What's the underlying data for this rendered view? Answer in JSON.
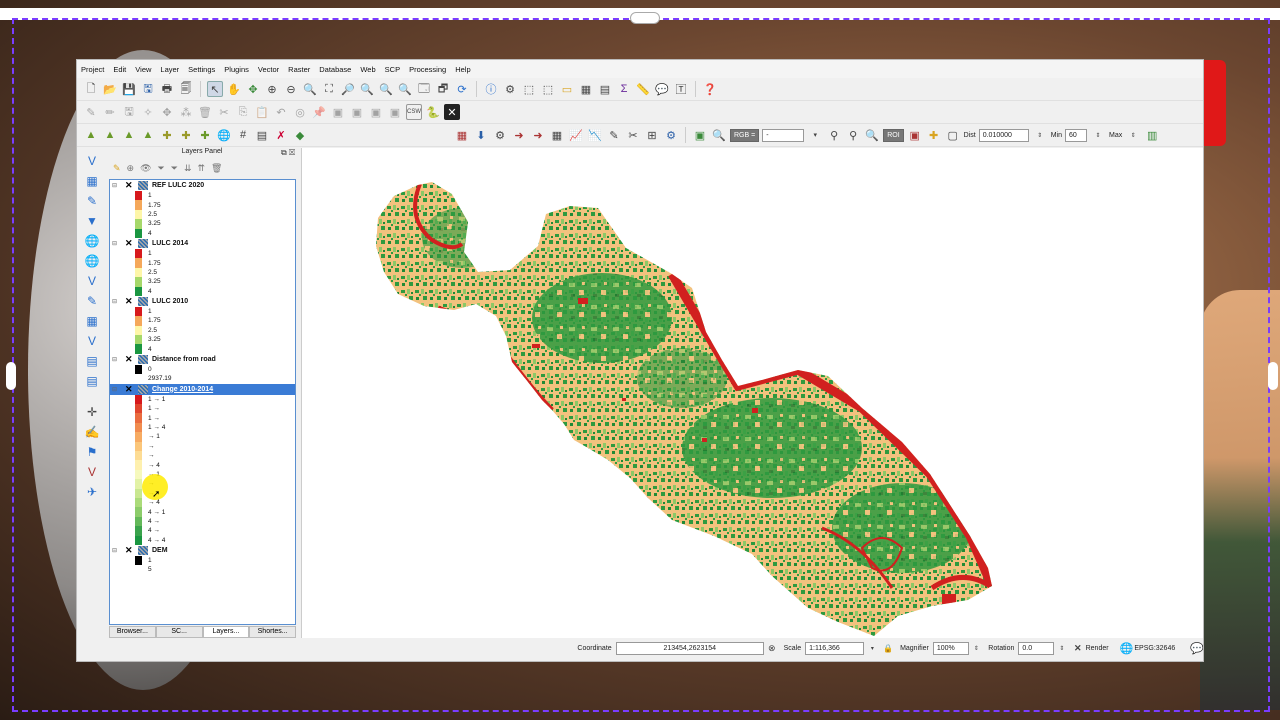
{
  "menu": [
    "Project",
    "Edit",
    "View",
    "Layer",
    "Settings",
    "Plugins",
    "Vector",
    "Raster",
    "Database",
    "Web",
    "SCP",
    "Processing",
    "Help"
  ],
  "toolbar3": {
    "rgb_label": "RGB =",
    "rgb_value": "-",
    "roi_label": "ROI",
    "dist_label": "Dist",
    "dist_value": "0.010000",
    "min_label": "Min",
    "min_value": "60",
    "max_label": "Max"
  },
  "panel": {
    "title": "Layers Panel",
    "tabs": [
      "Browser...",
      "SC...",
      "Layers...",
      "Shortes..."
    ]
  },
  "layers": [
    {
      "name": "REF LULC 2020",
      "legend": [
        {
          "label": "1",
          "color": "#d7191c"
        },
        {
          "label": "1.75",
          "color": "#f5a85a"
        },
        {
          "label": "2.5",
          "color": "#fef6a8"
        },
        {
          "label": "3.25",
          "color": "#a6d86a"
        },
        {
          "label": "4",
          "color": "#1a9641"
        }
      ]
    },
    {
      "name": "LULC 2014",
      "legend": [
        {
          "label": "1",
          "color": "#d7191c"
        },
        {
          "label": "1.75",
          "color": "#f5a85a"
        },
        {
          "label": "2.5",
          "color": "#fef6a8"
        },
        {
          "label": "3.25",
          "color": "#a6d86a"
        },
        {
          "label": "4",
          "color": "#1a9641"
        }
      ]
    },
    {
      "name": "LULC 2010",
      "legend": [
        {
          "label": "1",
          "color": "#d7191c"
        },
        {
          "label": "1.75",
          "color": "#f5a85a"
        },
        {
          "label": "2.5",
          "color": "#fef6a8"
        },
        {
          "label": "3.25",
          "color": "#a6d86a"
        },
        {
          "label": "4",
          "color": "#1a9641"
        }
      ]
    },
    {
      "name": "Distance from road",
      "legend": [
        {
          "label": "0",
          "color": "#000000"
        },
        {
          "label": "2937.19",
          "color": "#ffffff"
        }
      ]
    },
    {
      "name": "Change 2010-2014",
      "selected": true,
      "legend": [
        {
          "label": "1 → 1",
          "color": "#d7191c"
        },
        {
          "label": "1 →",
          "color": "#e0452e"
        },
        {
          "label": "1 →",
          "color": "#ea6c3f"
        },
        {
          "label": "1 → 4",
          "color": "#f18c4f"
        },
        {
          "label": "→ 1",
          "color": "#f7ab62"
        },
        {
          "label": "→",
          "color": "#fbc67a"
        },
        {
          "label": "→",
          "color": "#fddc94"
        },
        {
          "label": "→ 4",
          "color": "#fef0ae"
        },
        {
          "label": "→ 1",
          "color": "#f6f9bd"
        },
        {
          "label": "→",
          "color": "#e2f2a6"
        },
        {
          "label": "→",
          "color": "#c9e790"
        },
        {
          "label": "→ 4",
          "color": "#abdb7a"
        },
        {
          "label": "4 → 1",
          "color": "#8ccc6a"
        },
        {
          "label": "4 →",
          "color": "#63b859"
        },
        {
          "label": "4 →",
          "color": "#3aa34c"
        },
        {
          "label": "4 → 4",
          "color": "#1a9641"
        }
      ]
    },
    {
      "name": "DEM",
      "legend": [
        {
          "label": "1",
          "color": "#000000"
        },
        {
          "label": "5",
          "color": "#ffffff"
        }
      ]
    }
  ],
  "status": {
    "coordinate_label": "Coordinate",
    "coordinate_value": "213454,2623154",
    "scale_label": "Scale",
    "scale_value": "1:116,366",
    "magnifier_label": "Magnifier",
    "magnifier_value": "100%",
    "rotation_label": "Rotation",
    "rotation_value": "0.0",
    "render_label": "Render",
    "crs_label": "EPSG:32646"
  },
  "map_colors": {
    "agri": "#f2c27e",
    "veg": "#2e9a3f",
    "light_veg": "#8cc866",
    "built": "#d1201f"
  }
}
